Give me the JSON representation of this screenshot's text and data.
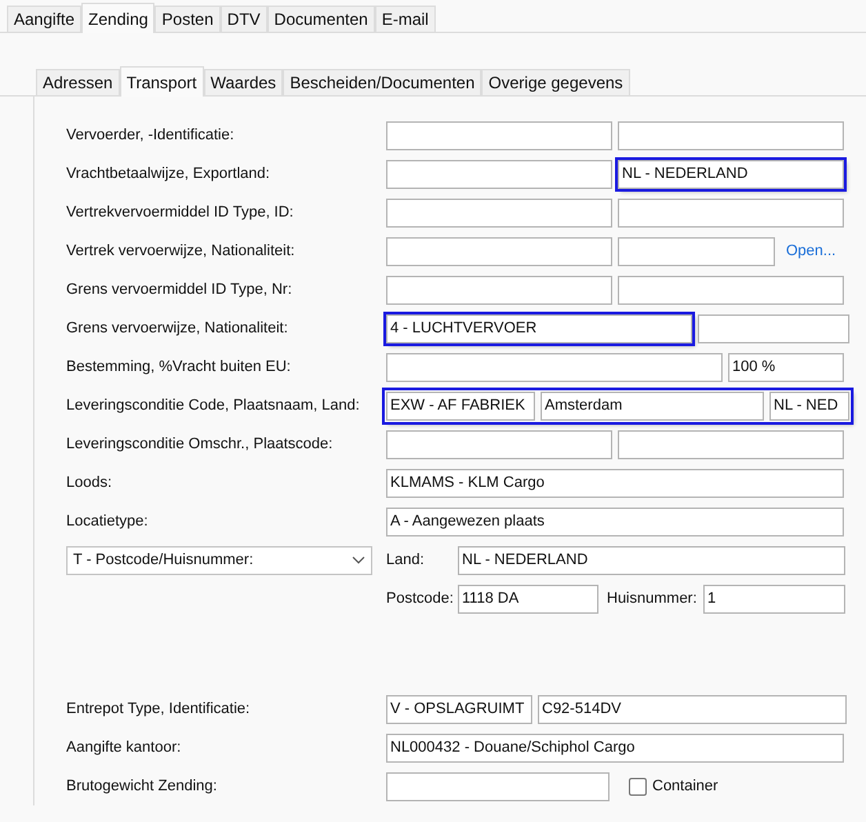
{
  "tabs": [
    {
      "label": "Aangifte",
      "selected": false
    },
    {
      "label": "Zending",
      "selected": true
    },
    {
      "label": "Posten",
      "selected": false
    },
    {
      "label": "DTV",
      "selected": false
    },
    {
      "label": "Documenten",
      "selected": false
    },
    {
      "label": "E-mail",
      "selected": false
    }
  ],
  "subtabs": [
    {
      "label": "Adressen",
      "selected": false
    },
    {
      "label": "Transport",
      "selected": true
    },
    {
      "label": "Waardes",
      "selected": false
    },
    {
      "label": "Bescheiden/Documenten",
      "selected": false
    },
    {
      "label": "Overige gegevens",
      "selected": false
    }
  ],
  "rows": [
    {
      "kind": "pair",
      "label": "Vervoerder, -Identificatie:",
      "highlighted": false,
      "fields": [
        {
          "highlighted": false
        },
        {
          "highlighted": false
        }
      ]
    },
    {
      "kind": "pair",
      "label": "Vrachtbetaalwijze, Exportland:",
      "highlighted": false,
      "fields": [
        {
          "highlighted": false
        },
        {
          "value": "NL - NEDERLAND",
          "highlighted": true
        }
      ]
    },
    {
      "kind": "pair",
      "label": "Vertrekvervoermiddel ID Type, ID:",
      "highlighted": false,
      "fields": [
        {
          "highlighted": false
        },
        {
          "highlighted": false
        }
      ]
    },
    {
      "kind": "pair-link",
      "label": "Vertrek vervoerwijze, Nationaliteit:",
      "highlighted": false,
      "link": "Open...",
      "fields": [
        {
          "highlighted": false
        },
        {
          "highlighted": false
        }
      ]
    },
    {
      "kind": "pair",
      "label": "Grens vervoermiddel ID Type, Nr:",
      "highlighted": false,
      "fields": [
        {
          "highlighted": false
        },
        {
          "highlighted": false
        }
      ]
    },
    {
      "kind": "wide",
      "label": "Grens vervoerwijze, Nationaliteit:",
      "highlighted": false,
      "fields": [
        {
          "value": "4 - LUCHTVERVOER",
          "highlighted": true
        },
        {
          "highlighted": false
        }
      ]
    },
    {
      "kind": "percent",
      "label": "Bestemming, %Vracht buiten EU:",
      "highlighted": false,
      "fields": [
        {
          "highlighted": false
        },
        {
          "value": "100 %",
          "highlighted": false
        }
      ]
    },
    {
      "kind": "triple",
      "label": "Leveringsconditie Code, Plaatsnaam, Land:",
      "highlighted": true,
      "fields": [
        {
          "value": "EXW - AF FABRIEK",
          "highlighted": false
        },
        {
          "value": "Amsterdam",
          "highlighted": false
        },
        {
          "value": "NL - NED",
          "highlighted": false
        }
      ]
    },
    {
      "kind": "pair",
      "label": "Leveringsconditie Omschr., Plaatscode:",
      "highlighted": false,
      "fields": [
        {
          "highlighted": false
        },
        {
          "highlighted": false
        }
      ]
    },
    {
      "kind": "single",
      "label": "Loods:",
      "highlighted": false,
      "fields": [
        {
          "value": "KLMAMS - KLM Cargo",
          "highlighted": false
        }
      ]
    },
    {
      "kind": "single",
      "label": "Locatietype:",
      "highlighted": false,
      "fields": [
        {
          "value": "A - Aangewezen plaats",
          "highlighted": false
        }
      ]
    }
  ],
  "address": {
    "select": "T - Postcode/Huisnummer:",
    "land_label": "Land:",
    "land": "NL - NEDERLAND",
    "postcode_label": "Postcode:",
    "postcode": "1118 DA",
    "huisnummer_label": "Huisnummer:",
    "huisnummer": "1"
  },
  "rows_bottom": [
    {
      "kind": "entrepot",
      "label": "Entrepot Type, Identificatie:",
      "highlighted": false,
      "fields": [
        {
          "value": "V - OPSLAGRUIMT",
          "highlighted": false
        },
        {
          "value": "C92-514DV",
          "highlighted": false
        }
      ]
    },
    {
      "kind": "single",
      "label": "Aangifte kantoor:",
      "highlighted": false,
      "fields": [
        {
          "value": "NL000432 - Douane/Schiphol Cargo",
          "highlighted": false
        }
      ]
    },
    {
      "kind": "weight",
      "label": "Brutogewicht Zending:",
      "highlighted": false,
      "fields": [
        {
          "highlighted": false
        }
      ],
      "checkbox": {
        "label": "Container",
        "checked": false
      }
    }
  ]
}
